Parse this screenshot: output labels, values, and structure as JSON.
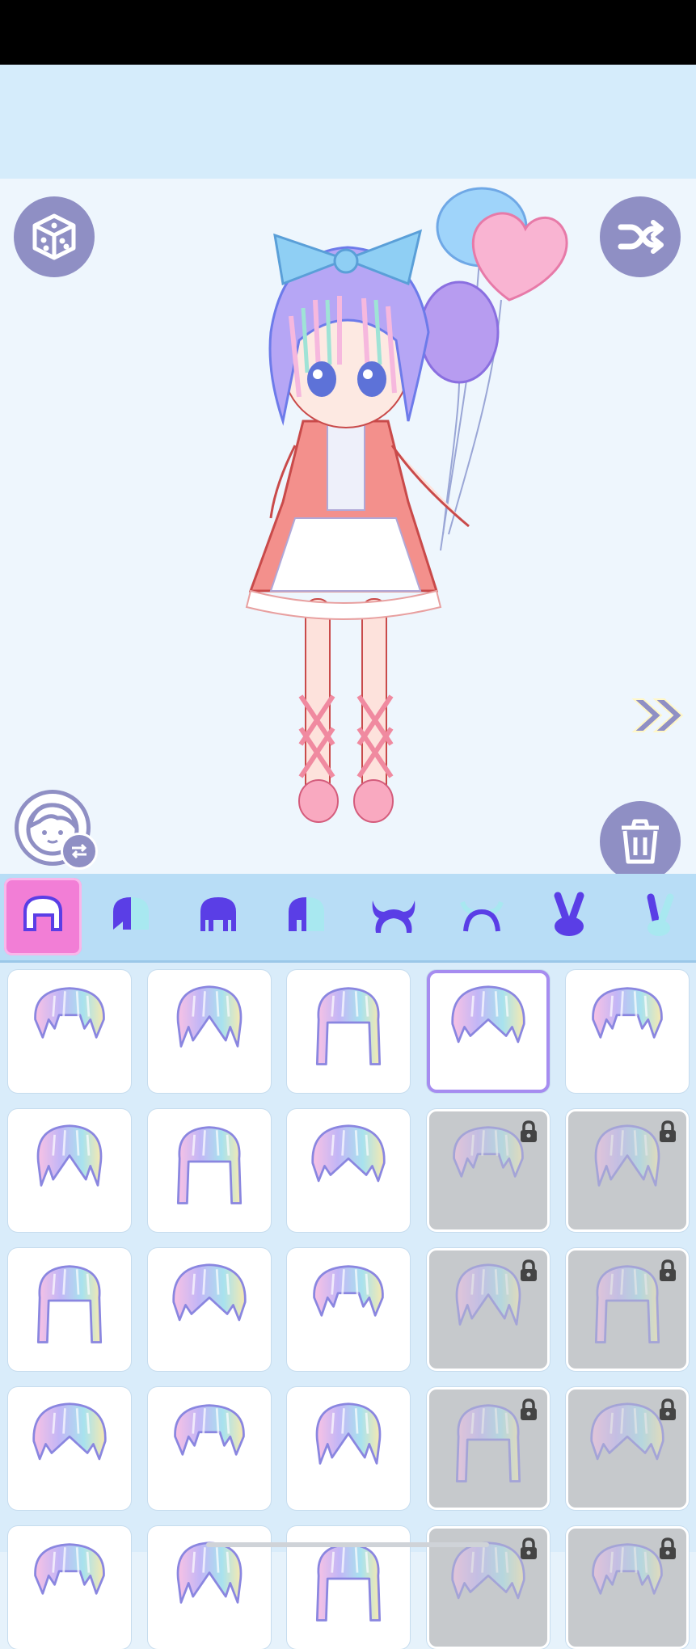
{
  "colors": {
    "accent_purple": "#8f8fc4",
    "tab_active": "#f27ed6",
    "tab_icon": "#5a3ee6",
    "locked_cell": "#c6c9cc",
    "selected_border": "#a68cf0"
  },
  "left_buttons": [
    {
      "name": "random-dice-button",
      "icon": "dice-icon"
    },
    {
      "name": "change-face-button",
      "icon": "face-swap-icon"
    }
  ],
  "right_buttons": [
    {
      "name": "shuffle-button",
      "icon": "shuffle-icon"
    },
    {
      "name": "delete-button",
      "icon": "trash-icon"
    }
  ],
  "tabs": [
    {
      "icon": "hair-front-icon",
      "active": true
    },
    {
      "icon": "hair-front-color-icon",
      "active": false
    },
    {
      "icon": "hair-back-icon",
      "active": false
    },
    {
      "icon": "hair-back-color-icon",
      "active": false
    },
    {
      "icon": "horns-icon",
      "active": false
    },
    {
      "icon": "horns-color-icon",
      "active": false
    },
    {
      "icon": "bunny-ears-icon",
      "active": false
    },
    {
      "icon": "bunny-ears-color-icon",
      "active": false
    }
  ],
  "hair_items": [
    {
      "state": "normal"
    },
    {
      "state": "normal"
    },
    {
      "state": "normal"
    },
    {
      "state": "selected"
    },
    {
      "state": "normal"
    },
    {
      "state": "normal"
    },
    {
      "state": "normal"
    },
    {
      "state": "normal"
    },
    {
      "state": "locked"
    },
    {
      "state": "locked"
    },
    {
      "state": "normal"
    },
    {
      "state": "normal"
    },
    {
      "state": "normal"
    },
    {
      "state": "locked"
    },
    {
      "state": "locked"
    },
    {
      "state": "normal"
    },
    {
      "state": "normal"
    },
    {
      "state": "normal"
    },
    {
      "state": "locked"
    },
    {
      "state": "locked"
    },
    {
      "state": "normal"
    },
    {
      "state": "normal"
    },
    {
      "state": "normal"
    },
    {
      "state": "locked"
    },
    {
      "state": "locked"
    }
  ]
}
